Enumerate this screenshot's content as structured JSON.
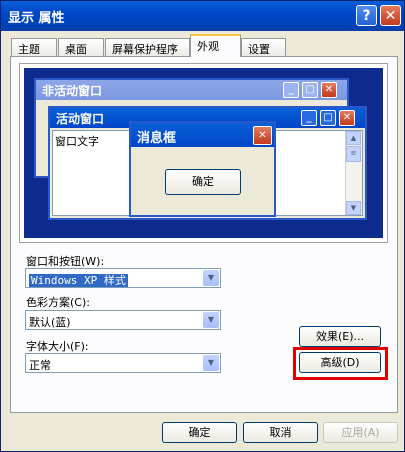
{
  "window": {
    "title": "显示 属性"
  },
  "tabs": [
    {
      "label": "主题"
    },
    {
      "label": "桌面"
    },
    {
      "label": "屏幕保护程序"
    },
    {
      "label": "外观"
    },
    {
      "label": "设置"
    }
  ],
  "preview": {
    "inactive_title": "非活动窗口",
    "active_title": "活动窗口",
    "window_text": "窗口文字",
    "message_title": "消息框",
    "message_ok": "确定"
  },
  "fields": {
    "style_label": "窗口和按钮(W):",
    "style_value": "Windows XP 样式",
    "scheme_label": "色彩方案(C):",
    "scheme_value": "默认(蓝)",
    "font_label": "字体大小(F):",
    "font_value": "正常"
  },
  "buttons": {
    "effects": "效果(E)...",
    "advanced": "高级(D)",
    "ok": "确定",
    "cancel": "取消",
    "apply": "应用(A)"
  },
  "icons": {
    "help": "?",
    "close": "✕",
    "minimize": "_",
    "maximize": "□",
    "dropdown": "▼"
  }
}
